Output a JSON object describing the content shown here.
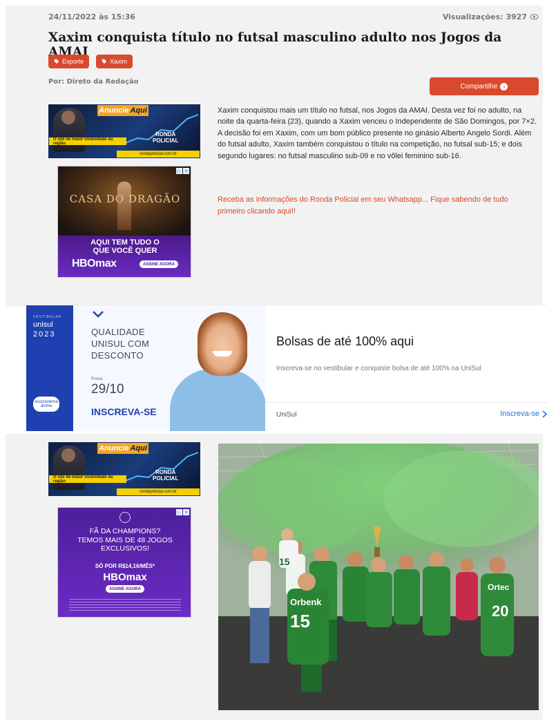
{
  "article": {
    "date": "24/11/2022 às 15:36",
    "views": "Visualizações: 3927",
    "title": "Xaxim conquista título no futsal masculino adulto nos Jogos da AMAI",
    "tags": [
      "Esporte",
      "Xaxim"
    ],
    "author": "Por: Direto da Redação",
    "share_label": "Compartilhe",
    "body": "Xaxim conquistou mais um título no futsal, nos Jogos da AMAI. Desta vez foi no adulto, na noite da quarta-feira (23), quando a Xaxim venceu o Independente de São Domingos, por 7×2. A decisão foi em Xaxim, com um bom público presente no ginásio Alberto Angelo Sordi. Além do futsal adulto, Xaxim também conquistou o título na competição, no futsal sub-15; e dois segundo lugares: no futsal masculino sub-09 e no vôlei feminino sub-16.",
    "whatsapp_cta": "Receba as informações do Ronda Policial em seu Whatsapp... Fique sabendo de tudo primeiro clicando aqui!!"
  },
  "banner_ad": {
    "label_1": "Anuncie",
    "label_2": "Aqui",
    "strip": "O site de maior visibilidade da região",
    "logo_1": "RONDA",
    "logo_2": "POLICIAL",
    "url": "rondapolicial.com.br"
  },
  "hbo_ad_1": {
    "scene_title": "CASA DO DRAGÃO",
    "slogan_1": "AQUI TEM TUDO O",
    "slogan_2": "QUE VOCÊ QUER",
    "brand": "HBOmax",
    "cta": "ASSINE AGORA"
  },
  "unisul_ad": {
    "vestibular": "VESTIBULAR",
    "brand": "unisul",
    "year": "2023",
    "anima": "ecossistema ânima",
    "headline_1": "QUALIDADE",
    "headline_2": "UNISUL COM",
    "headline_3": "DESCONTO",
    "prova_label": "Prova:",
    "prova_date": "29/10",
    "cta": "INSCREVA-SE",
    "title": "Bolsas de até 100% aqui",
    "description": "Inscreva-se no vestibular e conquiste bolsa de até 100% na UniSul",
    "advertiser": "UniSul",
    "link": "Inscreva-se"
  },
  "hbo_ad_2": {
    "question_1": "FÃ DA CHAMPIONS?",
    "question_2": "TEMOS MAIS DE 48 JOGOS",
    "question_3": "EXCLUSIVOS!",
    "price": "SÓ POR R$14,16/MÊS*",
    "brand": "HBOmax",
    "cta": "ASSINE AGORA"
  },
  "photo": {
    "jersey_1": "15",
    "jersey_2": "Orbenk",
    "jersey_3": "15",
    "jersey_4": "Ortec",
    "jersey_5": "20"
  },
  "colors": {
    "accent": "#d9492e",
    "link": "#d24a2a",
    "unisul_blue": "#1f40b0",
    "hbo_purple": "#6b2cc4"
  }
}
